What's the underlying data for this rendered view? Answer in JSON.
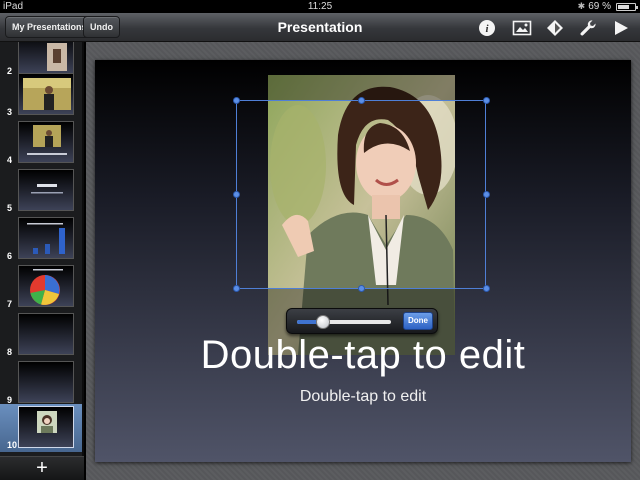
{
  "status": {
    "device": "iPad",
    "time": "11:25",
    "battery": "69 %",
    "battery_level": 0.69,
    "bluetooth_icon": "bluetooth-icon"
  },
  "toolbar": {
    "presentations_label": "My Presentations",
    "undo_label": "Undo",
    "title": "Presentation",
    "icons": [
      "info-icon",
      "media-icon",
      "animation-icon",
      "wrench-icon",
      "play-icon"
    ]
  },
  "slides": [
    {
      "number": "2"
    },
    {
      "number": "3"
    },
    {
      "number": "4"
    },
    {
      "number": "5"
    },
    {
      "number": "6"
    },
    {
      "number": "7"
    },
    {
      "number": "8"
    },
    {
      "number": "9"
    },
    {
      "number": "10"
    }
  ],
  "add_slide_label": "+",
  "slide": {
    "title": "Double-tap to edit",
    "subtitle": "Double-tap to edit"
  },
  "mask": {
    "done_label": "Done",
    "zoom_level": 0.28
  },
  "colors": {
    "accent": "#3f73d0",
    "selection": "#4f7fd6",
    "selected_row": "#6a8fbf"
  }
}
